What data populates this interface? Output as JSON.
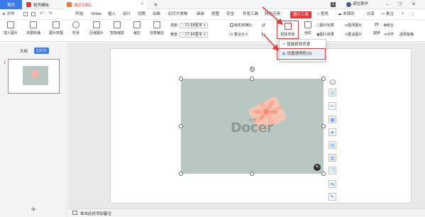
{
  "tabs": {
    "home": "首页",
    "docer": "稻壳模板",
    "active": "演示文稿1",
    "plus": "+"
  },
  "titlebar": {
    "user": "读往那作",
    "badge": "1"
  },
  "menu": {
    "file": "≡ 文件",
    "items": [
      "开始",
      "iSlide",
      "插入",
      "设计",
      "切换",
      "动画",
      "幻灯片放映",
      "审阅",
      "视图",
      "安全",
      "开发工具",
      "特色应用"
    ],
    "picture_tools": "图片工具",
    "search": "查找",
    "unsynced": "未保存",
    "share": "分享",
    "comment": "批注"
  },
  "ribbon": {
    "insert_picture": "插入图片",
    "multi_turn": "多图轮播",
    "picture_stitch": "图片拼图",
    "shape": "形状",
    "compress": "压缩图片",
    "smart_zoom": "智能缩放",
    "crop": "裁剪",
    "creative_crop": "创意裁剪",
    "height_label": "高度:",
    "height_value": "11.68厘米",
    "width_label": "宽度:",
    "width_value": "17.64厘米",
    "lock_ratio": "锁定纵横比",
    "reset_size": "重设大小",
    "remove_bg": "抠除背景",
    "color": "色彩",
    "picture_outline": "图片轮廓",
    "picture_effect": "图片效果",
    "change_picture": "更改图片",
    "reset_picture": "重设图片",
    "rotate": "旋转",
    "align": "对齐",
    "combine": "组合",
    "select_pane": "选择窗格"
  },
  "dropdown": {
    "smart_remove": "智能抠除背景",
    "set_transparent": "设置透明色(S)"
  },
  "leftpanel": {
    "outline": "大纲",
    "slides": "幻灯片",
    "slide_number": "1",
    "add": "+"
  },
  "slide_image": {
    "logo_text": "Docer",
    "logo_small": "稻壳"
  },
  "status": {
    "note_hint": "单击此处添加备注"
  },
  "colors": {
    "accent": "#e23a3a",
    "brand_blue": "#3b7be8",
    "image_bg": "#b9c7c2",
    "gift": "#f2b7a4"
  }
}
